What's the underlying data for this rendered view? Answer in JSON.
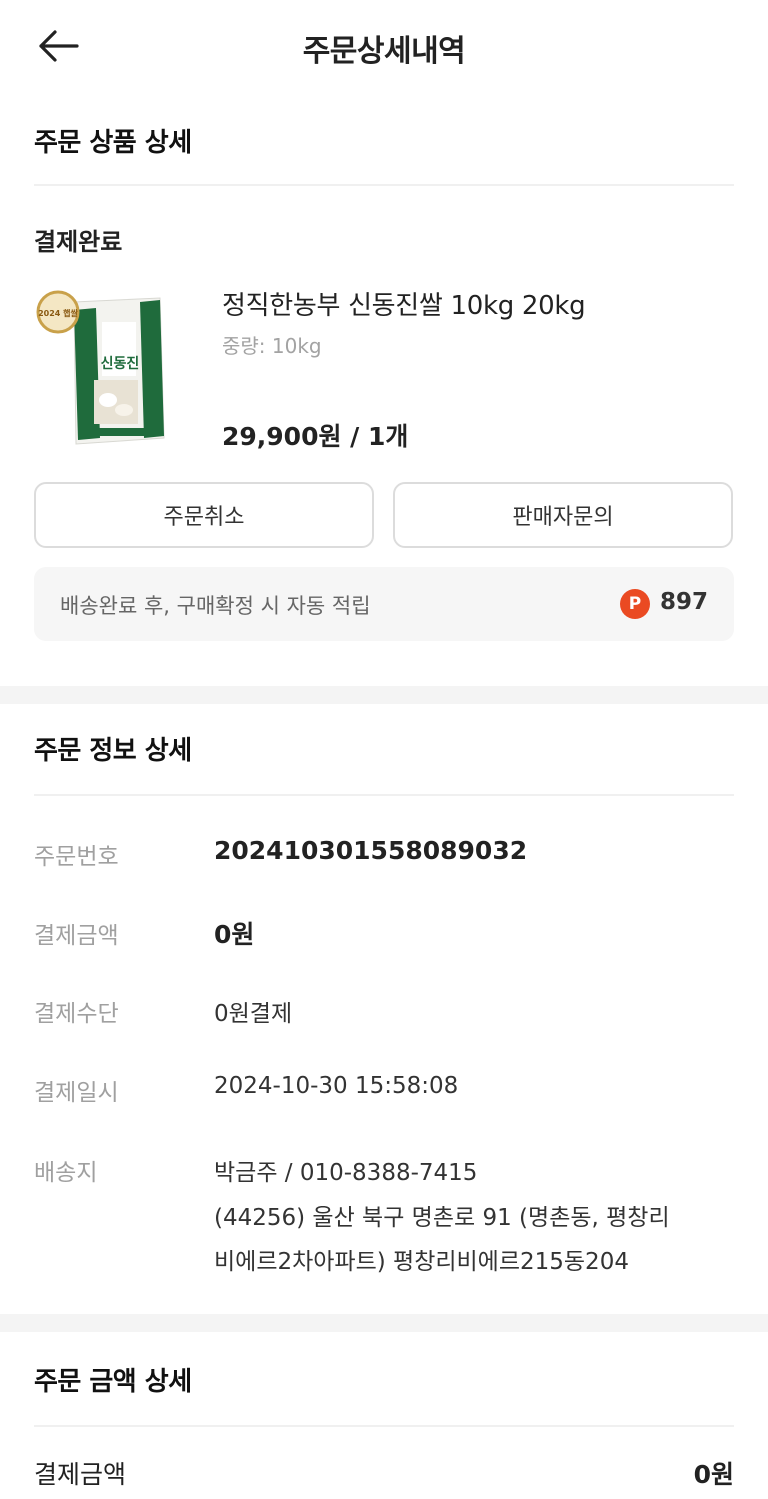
{
  "header": {
    "title": "주문상세내역"
  },
  "product_section": {
    "title": "주문 상품 상세",
    "status": "결제완료",
    "item": {
      "name": "정직한농부 신동진쌀 10kg 20kg",
      "option": "중량: 10kg",
      "price_qty": "29,900원 / 1개",
      "image": {
        "badge": "2024 햅쌀",
        "brand": "신동진",
        "colors": {
          "green": "#1f6b3c",
          "badge": "#c9a14a"
        }
      }
    },
    "buttons": {
      "cancel": "주문취소",
      "inquiry": "판매자문의"
    },
    "points": {
      "description": "배송완료 후, 구매확정 시 자동 적립",
      "icon": "P",
      "value": "897",
      "icon_color": "#ea4a22"
    }
  },
  "order_info": {
    "title": "주문 정보 상세",
    "rows": {
      "order_number": {
        "label": "주문번호",
        "value": "202410301558089032"
      },
      "amount": {
        "label": "결제금액",
        "value": "0원"
      },
      "method": {
        "label": "결제수단",
        "value": "0원결제"
      },
      "date": {
        "label": "결제일시",
        "value": "2024-10-30 15:58:08"
      },
      "address": {
        "label": "배송지",
        "lines": [
          "박금주 / 010-8388-7415",
          "(44256) 울산 북구 명촌로 91 (명촌동, 평창리",
          "비에르2차아파트) 평창리비에르215동204"
        ]
      }
    }
  },
  "amount_section": {
    "title": "주문 금액 상세",
    "total_label": "결제금액",
    "total_value": "0원"
  }
}
